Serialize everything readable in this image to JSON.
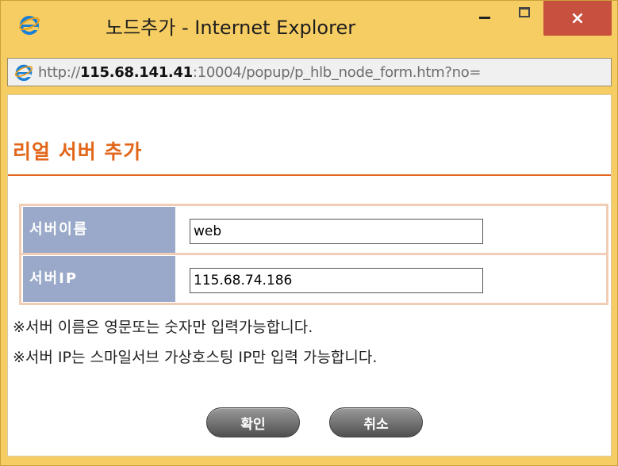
{
  "window": {
    "title": "노드추가 - Internet Explorer",
    "minimize_glyph": "–",
    "maximize_glyph": "□",
    "close_glyph": "×"
  },
  "address": {
    "scheme": "http://",
    "host": "115.68.141.41",
    "rest": ":10004/popup/p_hlb_node_form.htm?no="
  },
  "page": {
    "title": "리얼 서버 추가"
  },
  "form": {
    "server_name_label": "서버이름",
    "server_name_value": "web",
    "server_ip_label": "서버IP",
    "server_ip_value": "115.68.74.186"
  },
  "notes": {
    "note1": "※서버 이름은 영문또는 숫자만 입력가능합니다.",
    "note2": "※서버 IP는 스마일서브 가상호스팅 IP만 입력 가능합니다."
  },
  "buttons": {
    "ok": "확인",
    "cancel": "취소"
  },
  "colors": {
    "accent": "#e2661a",
    "label_bg": "#9aa9c9",
    "close_button": "#c7503f",
    "frame": "#f6cd62"
  },
  "icons": {
    "title_logo": "internet-explorer-icon",
    "address_logo": "internet-explorer-icon"
  }
}
